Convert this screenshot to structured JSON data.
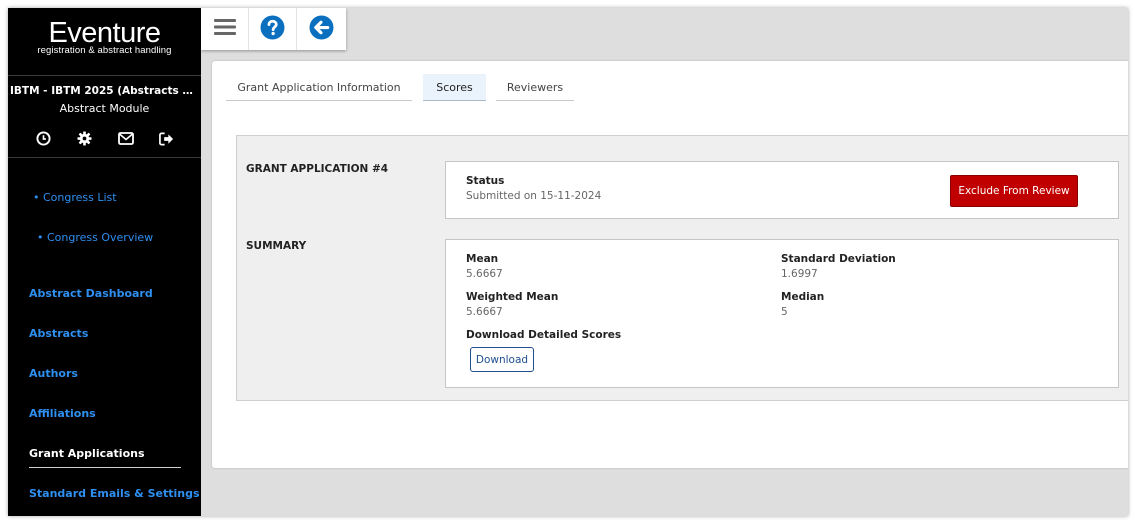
{
  "brand": {
    "title": "Eventure",
    "subtitle": "registration & abstract handling"
  },
  "sidebar": {
    "congress": "IBTM - IBTM 2025 (Abstracts & Participants)",
    "module": "Abstract Module",
    "icons": [
      "clock-icon",
      "gear-icon",
      "envelope-icon",
      "sign-out-icon"
    ],
    "sub_items": [
      {
        "label": "• Congress List"
      },
      {
        "label": "• Congress Overview"
      }
    ],
    "items": [
      {
        "label": "Abstract Dashboard"
      },
      {
        "label": "Abstracts"
      },
      {
        "label": "Authors"
      },
      {
        "label": "Affiliations"
      },
      {
        "label": "Grant Applications",
        "active": true
      },
      {
        "label": "Standard Emails & Settings"
      }
    ]
  },
  "toolbar": {
    "icons": [
      "menu-icon",
      "help-icon",
      "back-arrow-icon"
    ],
    "accent": "#0b6fbf"
  },
  "tabs": [
    {
      "label": "Grant Application Information"
    },
    {
      "label": "Scores",
      "active": true
    },
    {
      "label": "Reviewers"
    }
  ],
  "grant": {
    "section_label": "GRANT APPLICATION #4",
    "status_label": "Status",
    "status_value": "Submitted on 15-11-2024",
    "exclude_button": "Exclude From Review",
    "exclude_color": "#c00000"
  },
  "summary": {
    "section_label": "SUMMARY",
    "mean_label": "Mean",
    "mean_value": "5.6667",
    "sd_label": "Standard Deviation",
    "sd_value": "1.6997",
    "weighted_mean_label": "Weighted Mean",
    "weighted_mean_value": "5.6667",
    "median_label": "Median",
    "median_value": "5",
    "download_label": "Download Detailed Scores",
    "download_button": "Download"
  }
}
